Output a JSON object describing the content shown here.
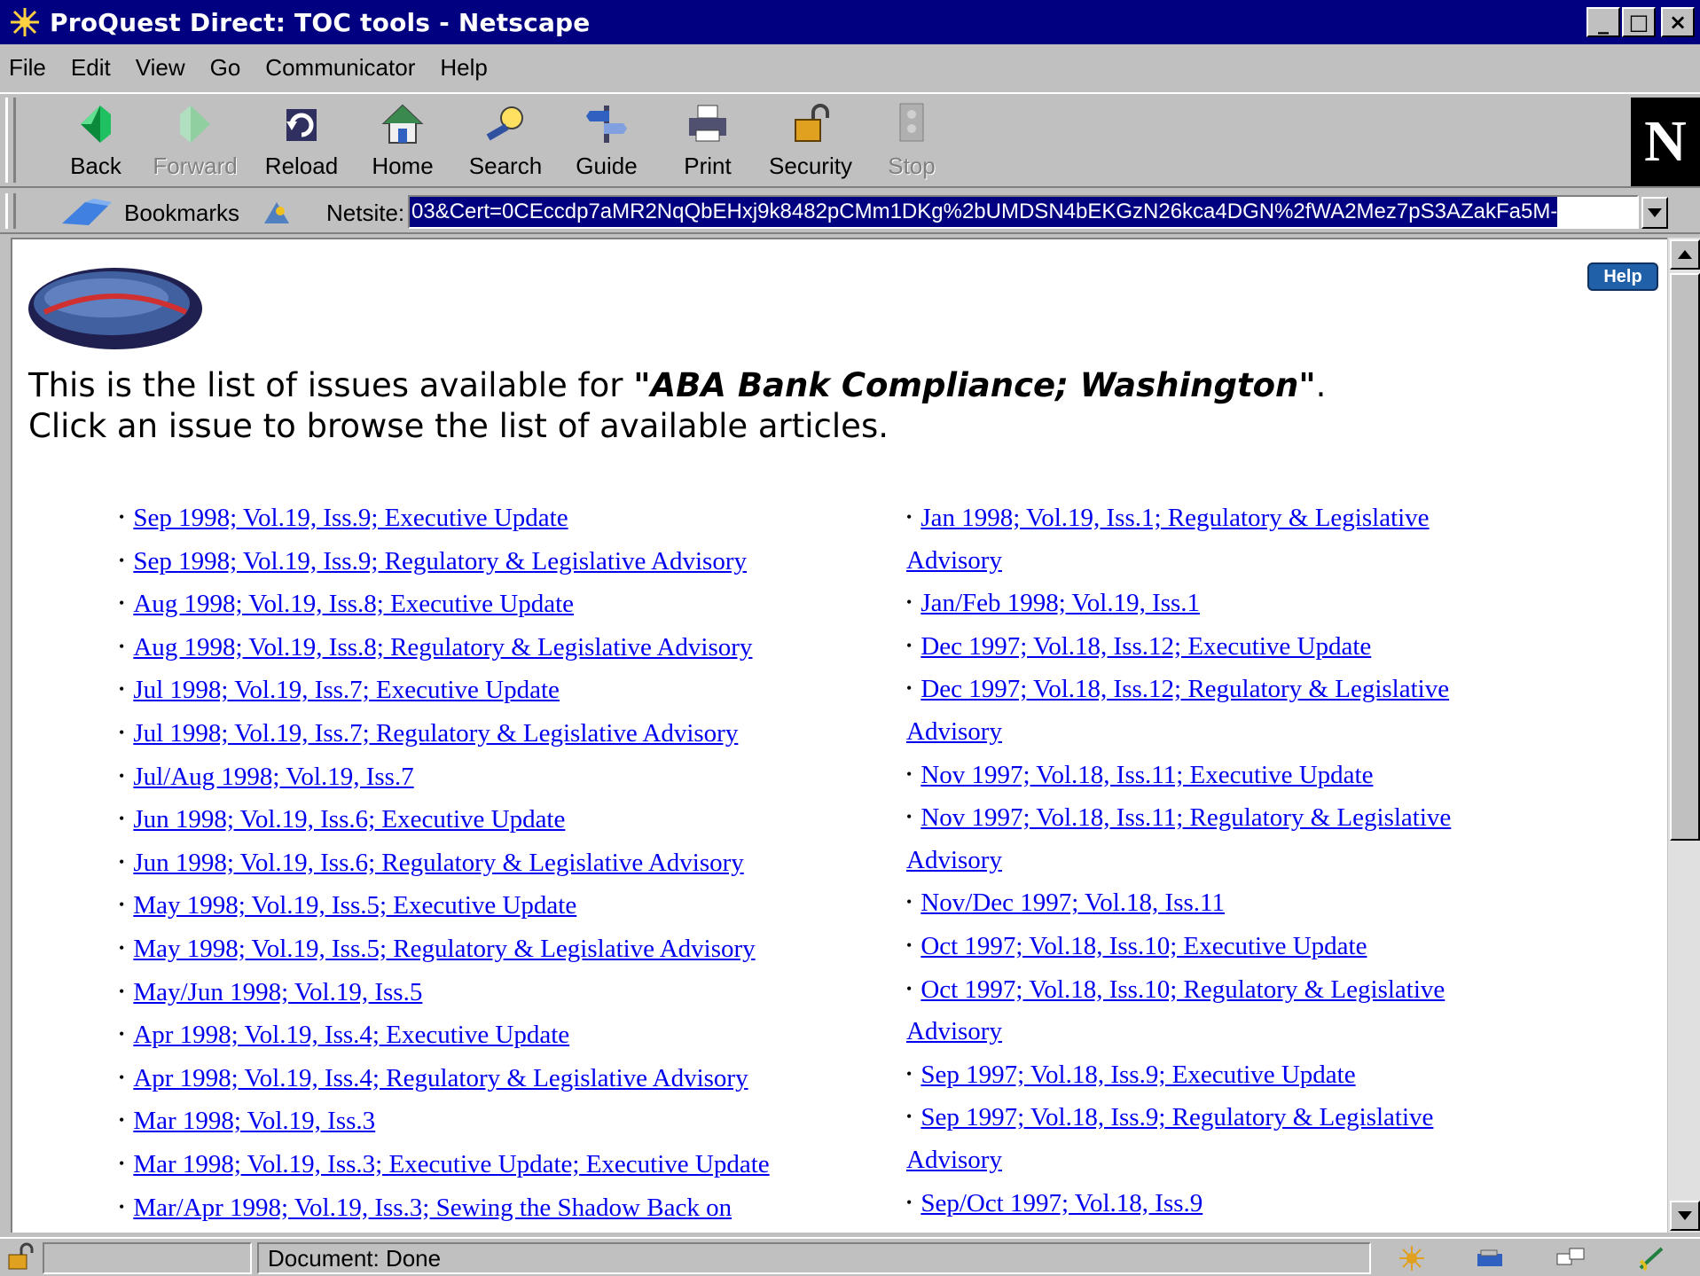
{
  "window": {
    "title": "ProQuest Direct: TOC tools - Netscape",
    "controls": [
      "_",
      "□",
      "×"
    ]
  },
  "menu": [
    "File",
    "Edit",
    "View",
    "Go",
    "Communicator",
    "Help"
  ],
  "toolbar": {
    "buttons": [
      {
        "label": "Back",
        "icon": "back-arrow-icon",
        "enabled": true
      },
      {
        "label": "Forward",
        "icon": "forward-arrow-icon",
        "enabled": false
      },
      {
        "label": "Reload",
        "icon": "reload-icon",
        "enabled": true
      },
      {
        "label": "Home",
        "icon": "home-icon",
        "enabled": true
      },
      {
        "label": "Search",
        "icon": "search-icon",
        "enabled": true
      },
      {
        "label": "Guide",
        "icon": "guide-icon",
        "enabled": true
      },
      {
        "label": "Print",
        "icon": "print-icon",
        "enabled": true
      },
      {
        "label": "Security",
        "icon": "security-icon",
        "enabled": true
      },
      {
        "label": "Stop",
        "icon": "stop-icon",
        "enabled": false
      }
    ],
    "brand": "N"
  },
  "location": {
    "bookmarks_label": "Bookmarks",
    "site_label": "Netsite:",
    "url": "03&Cert=0CEccdp7aMR2NqQbEHxj9k8482pCMm1DKg%2bUMDSN4bEKGzN26kca4DGN%2fWA2Mez7pS3AZakFa5M-"
  },
  "page": {
    "help_label": "Help",
    "intro_prefix": "This is the list of issues available for ",
    "intro_title": "\"ABA Bank Compliance; Washington\"",
    "intro_suffix": ".",
    "intro_line2": "Click an issue to browse the list of available articles.",
    "left_issues": [
      "Sep 1998; Vol.19, Iss.9; Executive Update",
      "Sep 1998; Vol.19, Iss.9; Regulatory & Legislative Advisory",
      "Aug 1998; Vol.19, Iss.8; Executive Update",
      "Aug 1998; Vol.19, Iss.8; Regulatory & Legislative Advisory",
      "Jul 1998; Vol.19, Iss.7; Executive Update",
      "Jul 1998; Vol.19, Iss.7; Regulatory & Legislative Advisory",
      "Jul/Aug 1998; Vol.19, Iss.7",
      "Jun 1998; Vol.19, Iss.6; Executive Update",
      "Jun 1998; Vol.19, Iss.6; Regulatory & Legislative Advisory",
      "May 1998; Vol.19, Iss.5; Executive Update",
      "May 1998; Vol.19, Iss.5; Regulatory & Legislative Advisory",
      "May/Jun 1998; Vol.19, Iss.5",
      "Apr 1998; Vol.19, Iss.4; Executive Update",
      "Apr 1998; Vol.19, Iss.4; Regulatory & Legislative Advisory",
      "Mar 1998; Vol.19, Iss.3",
      "Mar 1998; Vol.19, Iss.3; Executive Update; Executive Update",
      "Mar/Apr 1998; Vol.19, Iss.3; Sewing the Shadow Back on"
    ],
    "right_issues": [
      "Jan 1998; Vol.19, Iss.1; Regulatory & Legislative Advisory",
      "Jan/Feb 1998; Vol.19, Iss.1",
      "Dec 1997; Vol.18, Iss.12; Executive Update",
      "Dec 1997; Vol.18, Iss.12; Regulatory & Legislative Advisory",
      "Nov 1997; Vol.18, Iss.11; Executive Update",
      "Nov 1997; Vol.18, Iss.11; Regulatory & Legislative Advisory",
      "Nov/Dec 1997; Vol.18, Iss.11",
      "Oct 1997; Vol.18, Iss.10; Executive Update",
      "Oct 1997; Vol.18, Iss.10; Regulatory & Legislative Advisory",
      "Sep 1997; Vol.18, Iss.9; Executive Update",
      "Sep 1997; Vol.18, Iss.9; Regulatory & Legislative Advisory",
      "Sep/Oct 1997; Vol.18, Iss.9"
    ]
  },
  "status": {
    "text": "Document: Done"
  },
  "colors": {
    "title_bar": "#000080",
    "chrome": "#c0c0c0",
    "link": "#0000ee"
  }
}
